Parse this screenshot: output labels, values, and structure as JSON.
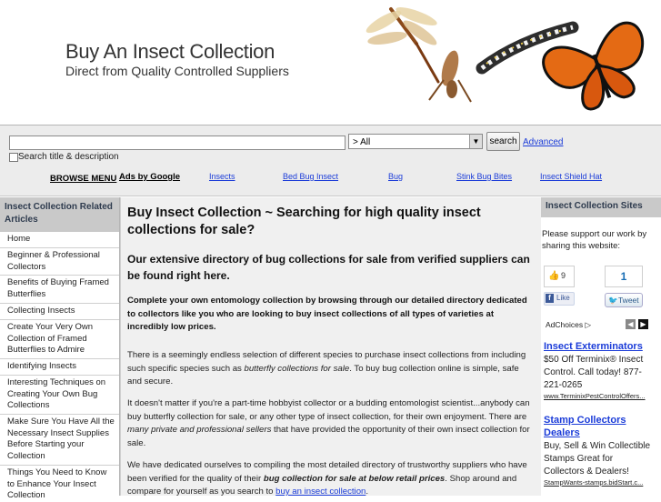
{
  "header": {
    "title": "Buy An Insect Collection",
    "subtitle": "Direct from Quality Controlled Suppliers"
  },
  "search": {
    "placeholder": "",
    "category_selected": "> All",
    "button_label": "search",
    "advanced_label": "Advanced",
    "checkbox_label": "Search title & description"
  },
  "nav": {
    "browse_label": "BROWSE MENU",
    "ads_by_label": "Ads by Google",
    "links": [
      "Insects",
      "Bed Bug Insect",
      "Bug",
      "Stink Bug Bites",
      "Insect Shield Hat"
    ]
  },
  "sidebar": {
    "heading": "Insect Collection Related Articles",
    "items": [
      "Home",
      "Beginner & Professional Collectors",
      "Benefits of Buying Framed Butterflies",
      "Collecting Insects",
      "Create Your Very Own Collection of Framed Butterflies to Admire",
      "Identifying Insects",
      "Interesting Techniques on Creating Your Own Bug Collections",
      "Make Sure You Have All the Necessary Insect Supplies Before Starting your Collection",
      "Things You Need to Know to Enhance Your Insect Collection"
    ]
  },
  "main": {
    "heading": "Buy Insect Collection ~ Searching for high quality insect collections for sale?",
    "subheading": "Our extensive directory of bug collections for sale from verified suppliers can be found right here.",
    "lead": "Complete your own entomology collection by browsing through our detailed directory dedicated to collectors like you who are looking to buy insect collections of all types of varieties at incredibly low prices.",
    "p1_a": "There is a seemingly endless selection of different species to purchase insect collections from including such specific species such as ",
    "p1_em": "butterfly collections for sale",
    "p1_b": ". To buy bug collection online is simple, safe and secure.",
    "p2_a": "It doesn't matter if you're a part-time hobbyist collector or a budding entomologist scientist...anybody can buy butterfly collection for sale, or any other type of insect collection, for their own enjoyment. There are ",
    "p2_em": "many private and professional sellers",
    "p2_b": " that have provided the opportunity of their own insect collection for sale.",
    "p3_a": "We have dedicated ourselves to compiling the most detailed directory of trustworthy suppliers who have been verified for the quality of their ",
    "p3_em": "bug collection for sale at below retail prices",
    "p3_b": ". Shop around and compare for yourself as you search to ",
    "p3_link": "buy an insect collection",
    "p3_c": "."
  },
  "rightbar": {
    "heading": "Insect Collection Sites",
    "support_text": "Please support our work by sharing this website:",
    "fb_count": "9",
    "fb_like": "Like",
    "tw_count": "1",
    "tw_label": "Tweet",
    "adchoices": "AdChoices",
    "ads": [
      {
        "title": "Insect Exterminators",
        "text": "$50 Off Terminix® Insect Control. Call today! 877-221-0265",
        "url": "www.TerminixPestControlOffers..."
      },
      {
        "title": "Stamp Collectors Dealers",
        "text": "Buy, Sell & Win Collectible Stamps Great for Collectors & Dealers!",
        "url": "StampWants-stamps.bidStart.c..."
      }
    ]
  },
  "colors": {
    "link": "#1a3bd8",
    "panel_gray": "#c9c9c9",
    "main_bg": "#f0f0f0",
    "heading_text": "#2e3b4e"
  }
}
